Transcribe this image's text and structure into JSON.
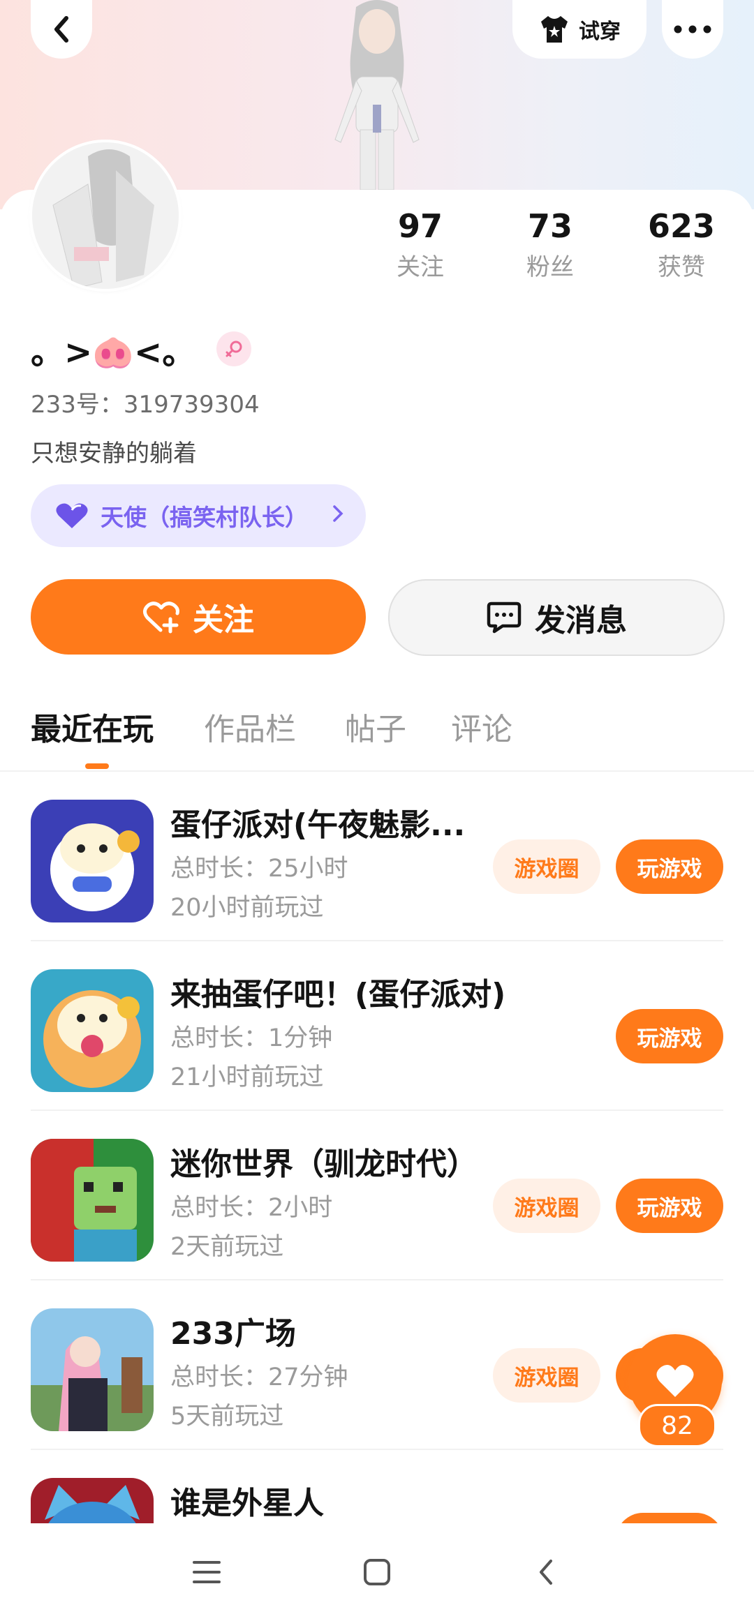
{
  "header": {
    "tryon_label": "试穿",
    "icons": [
      "back-icon",
      "shirt-icon",
      "more-icon"
    ]
  },
  "profile": {
    "nickname": "。>🐽<。",
    "uid_text": "233号：319739304",
    "bio": "只想安静的躺着",
    "title_badge": "天使（搞笑村队长）",
    "gender": "female",
    "stats": [
      {
        "value": "97",
        "label": "关注"
      },
      {
        "value": "73",
        "label": "粉丝"
      },
      {
        "value": "623",
        "label": "获赞"
      }
    ]
  },
  "actions": {
    "follow_label": "关注",
    "message_label": "发消息"
  },
  "tabs": [
    {
      "label": "最近在玩",
      "active": true
    },
    {
      "label": "作品栏",
      "active": false
    },
    {
      "label": "帖子",
      "active": false
    },
    {
      "label": "评论",
      "active": false
    }
  ],
  "games": [
    {
      "name": "蛋仔派对(午夜魅影...",
      "duration": "总时长：25小时",
      "last_played": "20小时前玩过",
      "circle_label": "游戏圈",
      "play_label": "玩游戏"
    },
    {
      "name": "来抽蛋仔吧！(蛋仔派对)",
      "duration": "总时长：1分钟",
      "last_played": "21小时前玩过",
      "circle_label": "",
      "play_label": "玩游戏"
    },
    {
      "name": "迷你世界（驯龙时代）",
      "duration": "总时长：2小时",
      "last_played": "2天前玩过",
      "circle_label": "游戏圈",
      "play_label": "玩游戏"
    },
    {
      "name": "233广场",
      "duration": "总时长：27分钟",
      "last_played": "5天前玩过",
      "circle_label": "游戏圈",
      "play_label": ""
    },
    {
      "name": "谁是外星人",
      "duration": "",
      "last_played": "",
      "circle_label": "",
      "play_label": ""
    }
  ],
  "like_fab": {
    "count": "82"
  },
  "colors": {
    "accent": "#ff7a1a",
    "badge_text": "#7a63f0",
    "badge_bg": "#ebe9ff"
  }
}
